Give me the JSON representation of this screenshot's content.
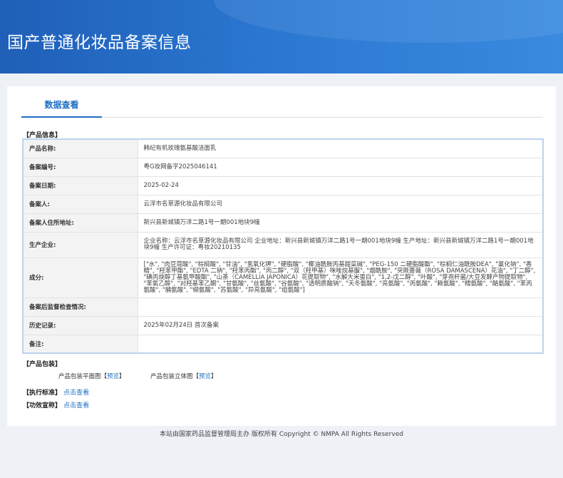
{
  "header": {
    "title": "国产普通化妆品备案信息"
  },
  "tabs": [
    {
      "label": "数据查看"
    }
  ],
  "product_info": {
    "section_label": "【产品信息】",
    "rows": [
      {
        "label": "产品名称:",
        "value": "韩纪有机玫瑰氨基酸洁面乳"
      },
      {
        "label": "备案编号:",
        "value": "粤G妆网备字2025046141"
      },
      {
        "label": "备案日期:",
        "value": "2025-02-24"
      },
      {
        "label": "备案人:",
        "value": "云浮市名草源化妆品有限公司"
      },
      {
        "label": "备案人住所地址:",
        "value": "新兴县新城镇万洋二路1号一期001地块9幢"
      },
      {
        "label": "生产企业:",
        "value": "企业名称：云浮市名草源化妆品有限公司 企业地址：新兴县新城镇万洋二路1号一期001地块9幢 生产地址：新兴县新城镇万洋二路1号一期001地块9幢 生产许可证：粤妆20210135"
      },
      {
        "label": "成分:",
        "value": "[\"水\", \"肉豆蔻酸\", \"棕榈酸\", \"甘油\", \"氢氧化钾\", \"硬脂酸\", \"椰油酰胺丙基甜菜碱\", \"PEG-150 二硬脂酸酯\", \"棕榈仁油酰胺DEA\", \"氯化钠\", \"香精\", \"羟苯甲酯\", \"EDTA 二钠\", \"羟苯丙酯\", \"丙二醇\", \"双（羟甲基）咪唑烷基脲\", \"烟酰胺\", \"突厥蔷薇（ROSA DAMASCENA）花油\", \"丁二醇\", \"碘丙炔醇丁基氨甲酸酯\", \"山茶（CAMELLIA JAPONICA）花提取物\", \"水解大米蛋白\", \"1,2-戊二醇\", \"叶酸\", \"芽孢杆菌/大豆发酵产物提取物\", \"苯氧乙醇\", \"对羟基苯乙酮\", \"甘氨酸\", \"丝氨酸\", \"谷氨酸\", \"透明质酸钠\", \"天冬氨酸\", \"亮氨酸\", \"丙氨酸\", \"赖氨酸\", \"精氨酸\", \"酪氨酸\", \"苯丙氨酸\", \"脯氨酸\", \"缬氨酸\", \"苏氨酸\", \"异亮氨酸\", \"组氨酸\"]"
      },
      {
        "label": "备案后监督检查情况:",
        "value": ""
      },
      {
        "label": "历史记录:",
        "value": "2025年02月24日 首次备案"
      },
      {
        "label": "备注:",
        "value": ""
      }
    ]
  },
  "packaging": {
    "section_label": "【产品包装】",
    "flat_label": "产品包装平面图",
    "solid_label": "产品包装立体图",
    "bracket_open": "【",
    "bracket_close": "】",
    "preview_link": "预览"
  },
  "standard": {
    "label": "【执行标准】",
    "link": "点击查看"
  },
  "efficacy": {
    "label": "【功效宣称】",
    "link": "点击查看"
  },
  "footer": {
    "text": "本站由国家药品监督管理局主办 版权所有 Copyright © NMPA All Rights Reserved"
  }
}
